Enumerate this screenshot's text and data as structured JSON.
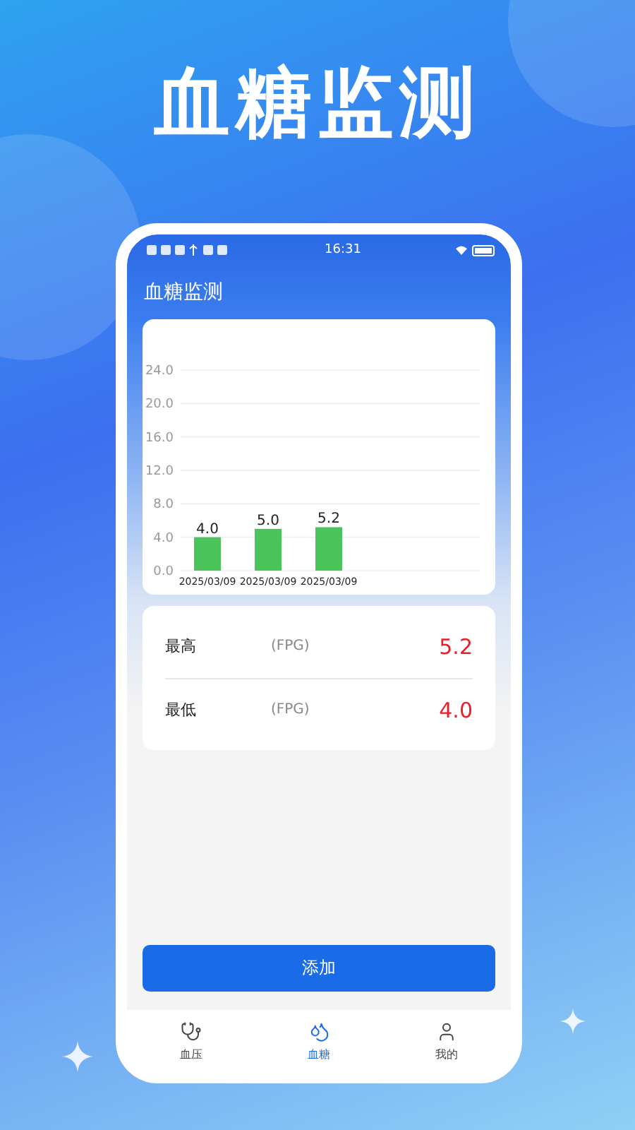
{
  "headline": "血糖监测",
  "status_bar": {
    "time": "16:31"
  },
  "header": {
    "title": "血糖监测"
  },
  "chart": {
    "chart_data": {
      "type": "bar",
      "categories": [
        "2025/03/09",
        "2025/03/09",
        "2025/03/09"
      ],
      "series": [
        {
          "color": "#4cc45c",
          "values": [
            4.0,
            5.0,
            5.2
          ]
        }
      ],
      "value_labels": [
        "4.0",
        "5.0",
        "5.2"
      ],
      "grid": true,
      "ylim": [
        0,
        24
      ],
      "yticks": [
        {
          "value": 0,
          "label": "0.0"
        },
        {
          "value": 4,
          "label": "4.0"
        },
        {
          "value": 8,
          "label": "8.0"
        },
        {
          "value": 12,
          "label": "12.0"
        },
        {
          "value": 16,
          "label": "16.0"
        },
        {
          "value": 20,
          "label": "20.0"
        },
        {
          "value": 24,
          "label": "24.0"
        }
      ]
    }
  },
  "stats": [
    {
      "label": "最高",
      "unit": "(FPG)",
      "value": "5.2"
    },
    {
      "label": "最低",
      "unit": "(FPG)",
      "value": "4.0"
    }
  ],
  "add_button": "添加",
  "tabs": [
    {
      "label": "血压",
      "selected": false
    },
    {
      "label": "血糖",
      "selected": true
    },
    {
      "label": "我的",
      "selected": false
    }
  ]
}
